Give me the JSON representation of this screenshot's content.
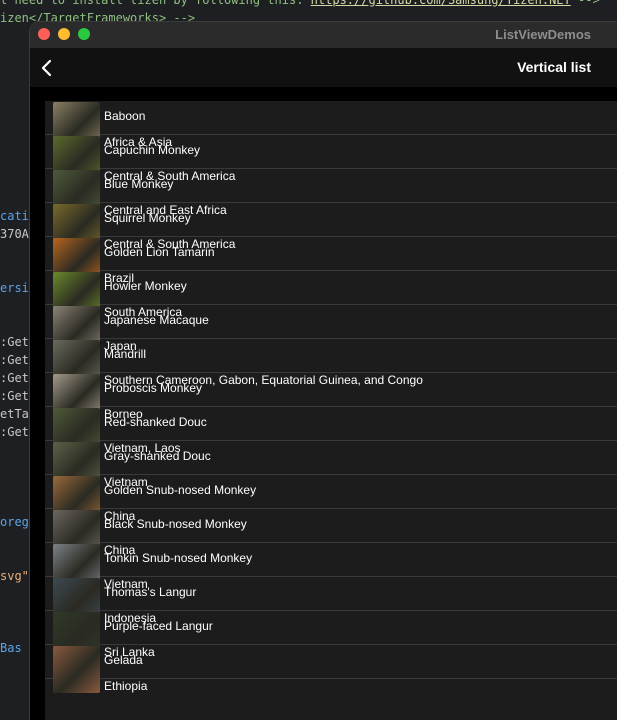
{
  "editor_bg": {
    "lines": [
      {
        "parts": [
          {
            "t": "l need to install tizen by following this: ",
            "c": "c-green"
          },
          {
            "t": "https://github.com/Samsung/Tizen.NET",
            "c": "lnk"
          },
          {
            "t": " -->",
            "c": "c-green"
          }
        ]
      },
      {
        "parts": [
          {
            "t": "izen</TargetFrameworks> -->",
            "c": "c-green"
          }
        ]
      },
      {
        "parts": [
          {
            "t": "cati",
            "c": "c-blue"
          }
        ]
      },
      {
        "parts": [
          {
            "t": "370A",
            "c": "c-gray"
          }
        ]
      },
      {
        "parts": [
          {
            "t": "ersi",
            "c": "c-blue"
          }
        ]
      },
      {
        "parts": [
          {
            "t": ":Get",
            "c": "c-gray"
          }
        ]
      },
      {
        "parts": [
          {
            "t": ":Get",
            "c": "c-gray"
          }
        ]
      },
      {
        "parts": [
          {
            "t": ":Get",
            "c": "c-gray"
          }
        ]
      },
      {
        "parts": [
          {
            "t": ":Get",
            "c": "c-gray"
          }
        ]
      },
      {
        "parts": [
          {
            "t": "etTa",
            "c": "c-gray"
          }
        ]
      },
      {
        "parts": [
          {
            "t": ":Get",
            "c": "c-gray"
          }
        ]
      },
      {
        "parts": [
          {
            "t": "oreg",
            "c": "c-blue"
          }
        ]
      },
      {
        "parts": [
          {
            "t": "svg\"",
            "c": "c-orange"
          }
        ]
      },
      {
        "parts": [
          {
            "t": "  Bas",
            "c": "c-blue"
          }
        ]
      }
    ]
  },
  "window": {
    "title": "ListViewDemos"
  },
  "navbar": {
    "title": "Vertical list",
    "back_icon": "chevron-left-icon"
  },
  "monkeys": [
    {
      "name": "Baboon",
      "location": "Africa & Asia",
      "color": "#8a8064"
    },
    {
      "name": "Capuchin Monkey",
      "location": "Central & South America",
      "color": "#5b6a2e"
    },
    {
      "name": "Blue Monkey",
      "location": "Central and East Africa",
      "color": "#4c5a3a"
    },
    {
      "name": "Squirrel Monkey",
      "location": "Central & South America",
      "color": "#7a6a2c"
    },
    {
      "name": "Golden Lion Tamarin",
      "location": "Brazil",
      "color": "#b8651e"
    },
    {
      "name": "Howler Monkey",
      "location": "South America",
      "color": "#6b8a2a"
    },
    {
      "name": "Japanese Macaque",
      "location": "Japan",
      "color": "#8c8378"
    },
    {
      "name": "Mandrill",
      "location": "Southern Cameroon, Gabon, Equatorial Guinea, and Congo",
      "color": "#6a6a5e"
    },
    {
      "name": "Proboscis Monkey",
      "location": "Borneo",
      "color": "#a49a8a"
    },
    {
      "name": "Red-shanked Douc",
      "location": "Vietnam, Laos",
      "color": "#4f5a3a"
    },
    {
      "name": "Gray-shanked Douc",
      "location": "Vietnam",
      "color": "#5c6248"
    },
    {
      "name": "Golden Snub-nosed Monkey",
      "location": "China",
      "color": "#9a6a3a"
    },
    {
      "name": "Black Snub-nosed Monkey",
      "location": "China",
      "color": "#6c6660"
    },
    {
      "name": "Tonkin Snub-nosed Monkey",
      "location": "Vietnam",
      "color": "#7d8288"
    },
    {
      "name": "Thomas's Langur",
      "location": "Indonesia",
      "color": "#3c4a52"
    },
    {
      "name": "Purple-faced Langur",
      "location": "Sri Lanka",
      "color": "#2e3a28"
    },
    {
      "name": "Gelada",
      "location": "Ethiopia",
      "color": "#8a5a3e"
    }
  ]
}
